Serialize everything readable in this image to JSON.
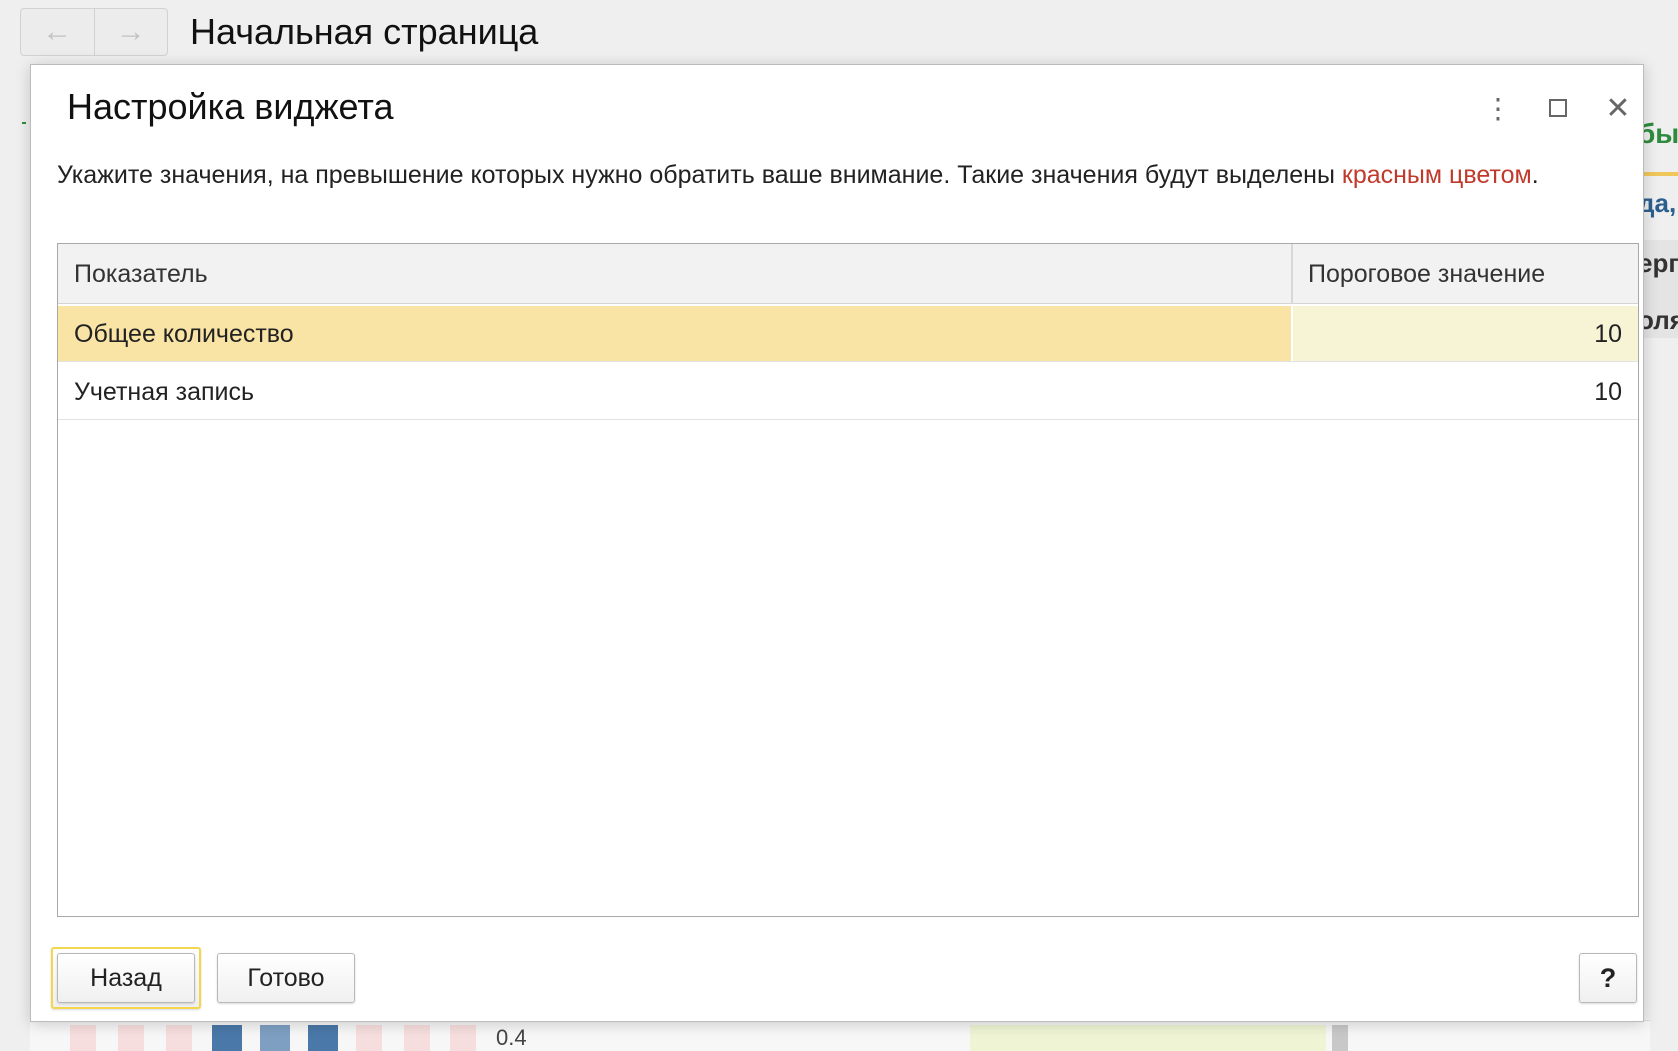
{
  "app": {
    "page_title": "Начальная страница",
    "nav_back_icon": "arrow-left-icon",
    "nav_forward_icon": "arrow-right-icon"
  },
  "background_peek": {
    "green_text": "бы",
    "blue_text": "да,",
    "dark_text_1": "ерг",
    "dark_text_2": "оля",
    "strip_label": "0.4"
  },
  "dialog": {
    "title": "Настройка виджета",
    "more_icon": "more-vertical-icon",
    "maximize_icon": "maximize-icon",
    "close_icon": "close-icon",
    "hint_text": "Укажите значения, на превышение которых нужно обратить ваше внимание. Такие значения будут выделены ",
    "hint_highlight": "красным цветом",
    "hint_end": ".",
    "highlight_color": "#c0392b",
    "table": {
      "headers": [
        "Показатель",
        "Пороговое значение"
      ],
      "rows": [
        {
          "indicator": "Общее количество",
          "threshold": "10",
          "selected": true
        },
        {
          "indicator": "Учетная запись",
          "threshold": "10",
          "selected": false
        }
      ]
    },
    "buttons": {
      "back": "Назад",
      "done": "Готово",
      "help": "?"
    }
  }
}
